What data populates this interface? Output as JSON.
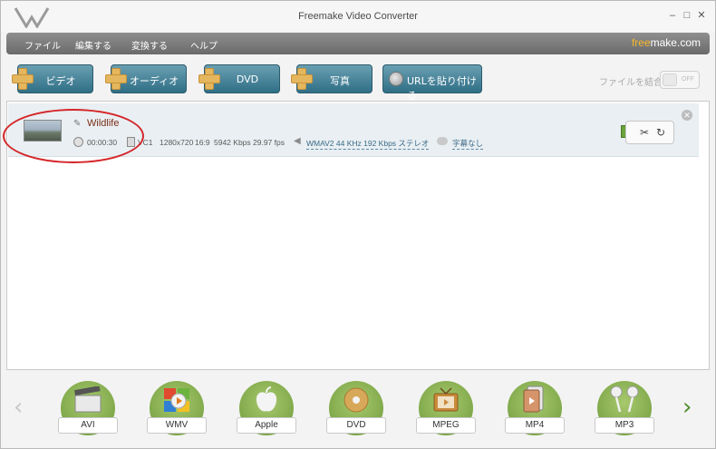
{
  "window": {
    "title": "Freemake Video Converter",
    "controls": [
      "–",
      "□",
      "✕"
    ]
  },
  "menu": {
    "items": [
      "ファイル",
      "編集する",
      "変換する",
      "ヘルプ"
    ],
    "brand_free": "free",
    "brand_rest": "make.com"
  },
  "toolbar": {
    "buttons": [
      "ビデオ",
      "オーディオ",
      "DVD",
      "写真"
    ],
    "url_button": "URLを貼り付ける",
    "join_label": "ファイルを結合",
    "toggle_state": "OFF"
  },
  "file": {
    "name": "Wildlife",
    "duration": "00:00:30",
    "video_codec": "VC1",
    "resolution": "1280x720",
    "aspect": "16:9",
    "bitrate": "5942 Kbps",
    "fps": "29.97 fps",
    "audio": "WMAV2  44 KHz  192 Kbps  ステレオ",
    "subtitles": "字幕なし"
  },
  "formats": [
    "AVI",
    "WMV",
    "Apple",
    "DVD",
    "MPEG",
    "MP4",
    "MP3"
  ],
  "colors": {
    "accent_blue": "#2f6f86",
    "format_green": "#6d9a3a",
    "highlight_red": "#d4262a",
    "filename": "#7b2e1a"
  }
}
